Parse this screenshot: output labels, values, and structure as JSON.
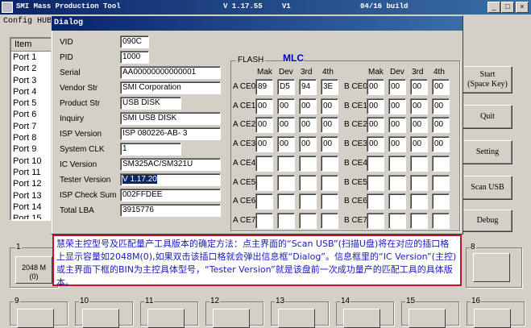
{
  "window": {
    "title_left": "SMI Mass Production Tool",
    "title_version": "V 1.17.55",
    "title_v": "V1",
    "title_build": "04/16 build",
    "buttons": [
      "_",
      "□",
      "×"
    ]
  },
  "menu": {
    "config": "Config HUB"
  },
  "port_list": {
    "header": "Item",
    "items": [
      "Port 1",
      "Port 2",
      "Port 3",
      "Port 4",
      "Port 5",
      "Port 6",
      "Port 7",
      "Port 8",
      "Port 9",
      "Port 10",
      "Port 11",
      "Port 12",
      "Port 13",
      "Port 14",
      "Port 15"
    ]
  },
  "dialog": {
    "title": "Dialog",
    "fields": [
      {
        "label": "VID",
        "value": "090C"
      },
      {
        "label": "PID",
        "value": "1000"
      },
      {
        "label": "Serial",
        "value": "AA00000000000001"
      },
      {
        "label": "Vendor Str",
        "value": "SMI Corporation"
      },
      {
        "label": "Product Str",
        "value": "USB DISK"
      },
      {
        "label": "Inquiry",
        "value": "SMI     USB DISK"
      },
      {
        "label": "ISP Version",
        "value": "ISP 080226-AB- 3"
      },
      {
        "label": "System CLK",
        "value": "1"
      },
      {
        "label": "IC Version",
        "value": "SM325AC/SM321U"
      },
      {
        "label": "Tester Version",
        "value": "V 1.17.20"
      },
      {
        "label": "ISP Check Sum",
        "value": "002FFDEE"
      },
      {
        "label": "Total LBA",
        "value": "3915776"
      }
    ],
    "flash": {
      "group_label": "FLASH",
      "mlc_label": "MLC",
      "col_headers": [
        "Mak",
        "Dev",
        "3rd",
        "4th"
      ],
      "a_rows": [
        {
          "label": "A CE0",
          "cells": [
            "89",
            "D5",
            "94",
            "3E"
          ]
        },
        {
          "label": "A CE1",
          "cells": [
            "00",
            "00",
            "00",
            "00"
          ]
        },
        {
          "label": "A CE2",
          "cells": [
            "00",
            "00",
            "00",
            "00"
          ]
        },
        {
          "label": "A CE3",
          "cells": [
            "00",
            "00",
            "00",
            "00"
          ]
        },
        {
          "label": "A CE4",
          "cells": [
            "",
            "",
            "",
            ""
          ]
        },
        {
          "label": "A CE5",
          "cells": [
            "",
            "",
            "",
            ""
          ]
        },
        {
          "label": "A CE6",
          "cells": [
            "",
            "",
            "",
            ""
          ]
        },
        {
          "label": "A CE7",
          "cells": [
            "",
            "",
            "",
            ""
          ]
        }
      ],
      "b_rows": [
        {
          "label": "B CE0",
          "cells": [
            "00",
            "00",
            "00",
            "00"
          ]
        },
        {
          "label": "B CE1",
          "cells": [
            "00",
            "00",
            "00",
            "00"
          ]
        },
        {
          "label": "B CE2",
          "cells": [
            "00",
            "00",
            "00",
            "00"
          ]
        },
        {
          "label": "B CE3",
          "cells": [
            "00",
            "00",
            "00",
            "00"
          ]
        },
        {
          "label": "B CE4",
          "cells": [
            "",
            "",
            "",
            ""
          ]
        },
        {
          "label": "B CE5",
          "cells": [
            "",
            "",
            "",
            ""
          ]
        },
        {
          "label": "B CE6",
          "cells": [
            "",
            "",
            "",
            ""
          ]
        },
        {
          "label": "B CE7",
          "cells": [
            "",
            "",
            "",
            ""
          ]
        }
      ]
    }
  },
  "right_buttons": {
    "start": "Start\n(Space Key)",
    "quit": "Quit",
    "setting": "Setting",
    "scan_usb": "Scan USB",
    "debug": "Debug"
  },
  "lower_panels": {
    "top_numbers": [
      "1",
      "8"
    ],
    "slot1_text": "2048 M\n(0)",
    "bottom_numbers": [
      "9",
      "10",
      "11",
      "12",
      "13",
      "14",
      "15",
      "16"
    ]
  },
  "annotation": {
    "text": "慧荣主控型号及匹配量产工具版本的确定方法：点主界面的“Scan USB”(扫描U盘)将在对应的插口格上显示容量如2048M(0),如果双击该插口格就会弹出信息框“Dialog”。信息框里的“IC Version”(主控)或主界面下框的BIN为主控具体型号，“Tester Version”就是该盘前一次成功量产的匹配工具的具体版本。"
  },
  "colors": {
    "title_bar": "#0a246a",
    "annotation_border": "#c0142c",
    "annotation_text": "#1a1ac0",
    "mlc": "#0000c0"
  }
}
